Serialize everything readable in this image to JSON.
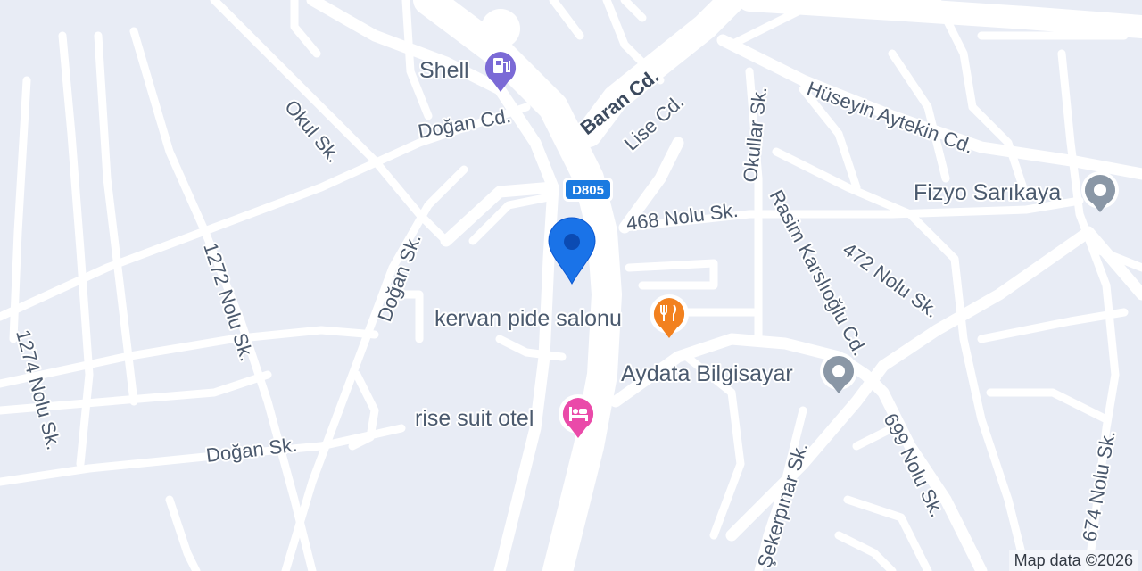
{
  "map": {
    "highway_shield": "D805",
    "streets": {
      "dogan_cd": "Doğan Cd.",
      "okul_sk": "Okul Sk.",
      "baran_cd": "Baran Cd.",
      "lise_cd": "Lise Cd.",
      "okullar_sk": "Okullar Sk.",
      "huseyin_aytekin_cd": "Hüseyin Aytekin Cd.",
      "nolu_468": "468 Nolu Sk.",
      "rasim_karslioglu_cd": "Rasim Karslıoğlu Cd.",
      "nolu_472": "472 Nolu Sk.",
      "dogan_sk_vertical": "Doğan Sk.",
      "nolu_1272": "1272 Nolu Sk.",
      "nolu_1274": "1274 Nolu Sk.",
      "dogan_sk": "Doğan Sk.",
      "sekerpinar_sk": "Şekerpınar Sk.",
      "nolu_699": "699 Nolu Sk.",
      "nolu_674": "674 Nolu Sk."
    },
    "pois": [
      {
        "name": "Shell",
        "icon": "gas-station-icon",
        "color": "#7b6ad6"
      },
      {
        "name": "Fizyo Sarıkaya",
        "icon": "generic-place-icon",
        "color": "#8a97a6"
      },
      {
        "name": "kervan pide salonu",
        "icon": "restaurant-icon",
        "color": "#f2811f"
      },
      {
        "name": "Aydata Bilgisayar",
        "icon": "generic-place-icon",
        "color": "#8a97a6"
      },
      {
        "name": "rise suit otel",
        "icon": "hotel-icon",
        "color": "#ea4aa9"
      }
    ],
    "marker": {
      "icon": "location-pin-icon",
      "color": "#1a73e8"
    },
    "colors": {
      "background": "#e8ecf5",
      "road": "#ffffff",
      "label": "#4c5a6e",
      "shield": "#1a7ae0"
    }
  },
  "attribution": "Map data ©2026"
}
